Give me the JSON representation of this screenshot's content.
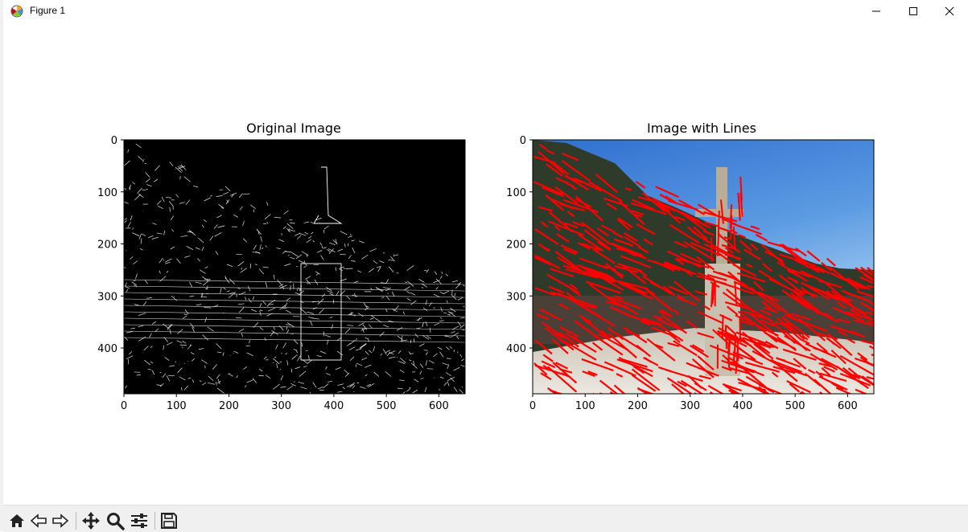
{
  "window": {
    "title": "Figure 1",
    "controls": [
      "minimize",
      "maximize",
      "close"
    ]
  },
  "toolbar": {
    "buttons": [
      {
        "name": "home-icon",
        "label": "Home"
      },
      {
        "name": "back-icon",
        "label": "Back"
      },
      {
        "name": "forward-icon",
        "label": "Forward"
      },
      {
        "name": "pan-icon",
        "label": "Pan"
      },
      {
        "name": "zoom-icon",
        "label": "Zoom"
      },
      {
        "name": "configure-subplots-icon",
        "label": "Configure subplots"
      },
      {
        "name": "save-icon",
        "label": "Save"
      }
    ]
  },
  "chart_data": [
    {
      "type": "image",
      "title": "Original Image",
      "description_kind": "canny-edge-map",
      "xlim": [
        0,
        650
      ],
      "ylim": [
        488,
        0
      ],
      "x_ticks": [
        0,
        100,
        200,
        300,
        400,
        500,
        600
      ],
      "y_ticks": [
        0,
        100,
        200,
        300,
        400
      ]
    },
    {
      "type": "image",
      "title": "Image with Lines",
      "description_kind": "photo-with-red-hough-lines",
      "xlim": [
        0,
        650
      ],
      "ylim": [
        488,
        0
      ],
      "x_ticks": [
        0,
        100,
        200,
        300,
        400,
        500,
        600
      ],
      "y_ticks": [
        0,
        100,
        200,
        300,
        400
      ],
      "line_color": "#ff0000"
    }
  ],
  "colors": {
    "sky_top": "#3a7fd6",
    "sky_bottom": "#bfe0f7",
    "line_red": "#ff0000"
  }
}
